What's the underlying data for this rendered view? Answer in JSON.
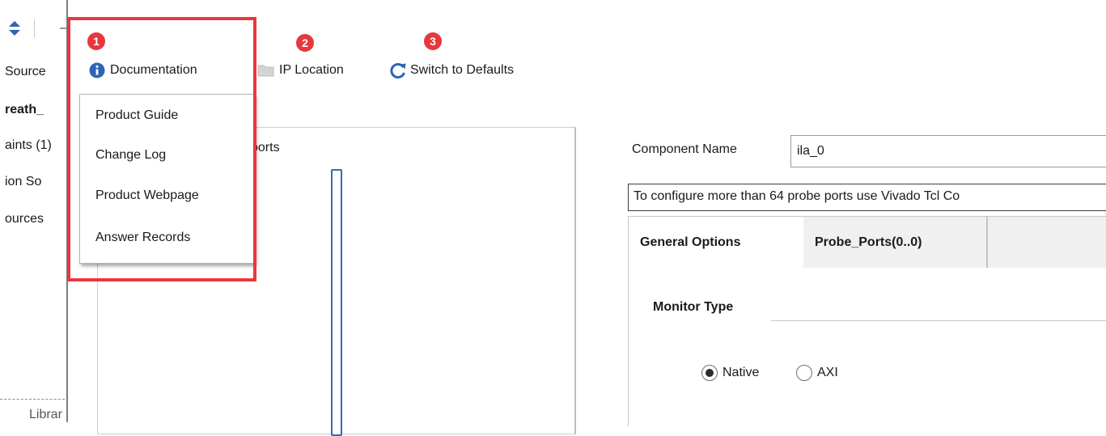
{
  "sidebar": {
    "fragments": [
      "Source",
      "reath_",
      "aints (1)",
      "ion So",
      "ources",
      "Librar"
    ]
  },
  "toolbar": {
    "documentation_label": "Documentation",
    "ip_location_label": "IP Location",
    "switch_defaults_label": "Switch to Defaults"
  },
  "annotations": {
    "badges": [
      "1",
      "2",
      "3"
    ]
  },
  "documentation_menu": {
    "items": [
      "Product Guide",
      "Change Log",
      "Product Webpage",
      "Answer Records"
    ]
  },
  "left_panel": {
    "ports_label_fragment": "ports"
  },
  "form": {
    "component_name_label": "Component Name",
    "component_name_value": "ila_0",
    "note": "To configure more than 64 probe ports use Vivado Tcl Co",
    "tabs": [
      "General Options",
      "Probe_Ports(0..0)"
    ],
    "monitor_type_label": "Monitor Type",
    "monitor_options": [
      "Native",
      "AXI"
    ],
    "monitor_selected": "Native"
  },
  "colors": {
    "highlight": "#e8383d",
    "badge": "#e8383d",
    "info_icon": "#2f64b5",
    "refresh_icon": "#2f64b5",
    "port_block": "#3a68b8"
  }
}
